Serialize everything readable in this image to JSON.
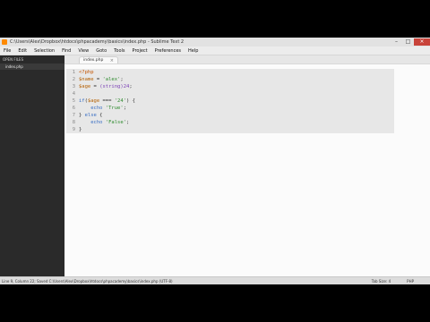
{
  "window": {
    "title": "C:\\Users\\Alex\\Dropbox\\htdocs\\phpacademy\\basics\\index.php - Sublime Text 2",
    "controls": {
      "minimize": "–",
      "maximize": "□",
      "close": "×"
    }
  },
  "menu": [
    "File",
    "Edit",
    "Selection",
    "Find",
    "View",
    "Goto",
    "Tools",
    "Project",
    "Preferences",
    "Help"
  ],
  "sidebar": {
    "header": "OPEN FILES",
    "file": "index.php"
  },
  "tab": {
    "label": "index.php",
    "close": "×"
  },
  "code_lines": [
    {
      "num": "1",
      "tokens": [
        {
          "t": "<?php",
          "c": "tok-tag"
        }
      ]
    },
    {
      "num": "2",
      "tokens": [
        {
          "t": "$name",
          "c": "tok-var"
        },
        {
          "t": " = ",
          "c": "tok-op"
        },
        {
          "t": "'alex'",
          "c": "tok-str"
        },
        {
          "t": ";",
          "c": "tok-op"
        }
      ]
    },
    {
      "num": "3",
      "tokens": [
        {
          "t": "$age",
          "c": "tok-var"
        },
        {
          "t": " = ",
          "c": "tok-op"
        },
        {
          "t": "(string)",
          "c": "tok-cast"
        },
        {
          "t": "24",
          "c": "tok-num"
        },
        {
          "t": ";",
          "c": "tok-op"
        }
      ]
    },
    {
      "num": "4",
      "tokens": []
    },
    {
      "num": "5",
      "tokens": [
        {
          "t": "if",
          "c": "tok-kw"
        },
        {
          "t": "(",
          "c": "tok-op"
        },
        {
          "t": "$age",
          "c": "tok-var"
        },
        {
          "t": " === ",
          "c": "tok-op"
        },
        {
          "t": "'24'",
          "c": "tok-str"
        },
        {
          "t": ") {",
          "c": "tok-op"
        }
      ]
    },
    {
      "num": "6",
      "tokens": [
        {
          "t": "    echo ",
          "c": "tok-kw"
        },
        {
          "t": "'True'",
          "c": "tok-str"
        },
        {
          "t": ";",
          "c": "tok-op"
        }
      ]
    },
    {
      "num": "7",
      "tokens": [
        {
          "t": "} ",
          "c": "tok-op"
        },
        {
          "t": "else",
          "c": "tok-kw"
        },
        {
          "t": " {",
          "c": "tok-op"
        }
      ]
    },
    {
      "num": "8",
      "tokens": [
        {
          "t": "    echo ",
          "c": "tok-kw"
        },
        {
          "t": "'False'",
          "c": "tok-str"
        },
        {
          "t": ";",
          "c": "tok-op"
        }
      ]
    },
    {
      "num": "9",
      "tokens": [
        {
          "t": "}",
          "c": "tok-op"
        }
      ]
    }
  ],
  "status": {
    "left": "Line 9, Column 22; Saved C:\\Users\\Alex\\Dropbox\\htdocs\\phpacademy\\basics\\index.php (UTF-8)",
    "tab_size": "Tab Size: 4",
    "syntax": "PHP"
  }
}
